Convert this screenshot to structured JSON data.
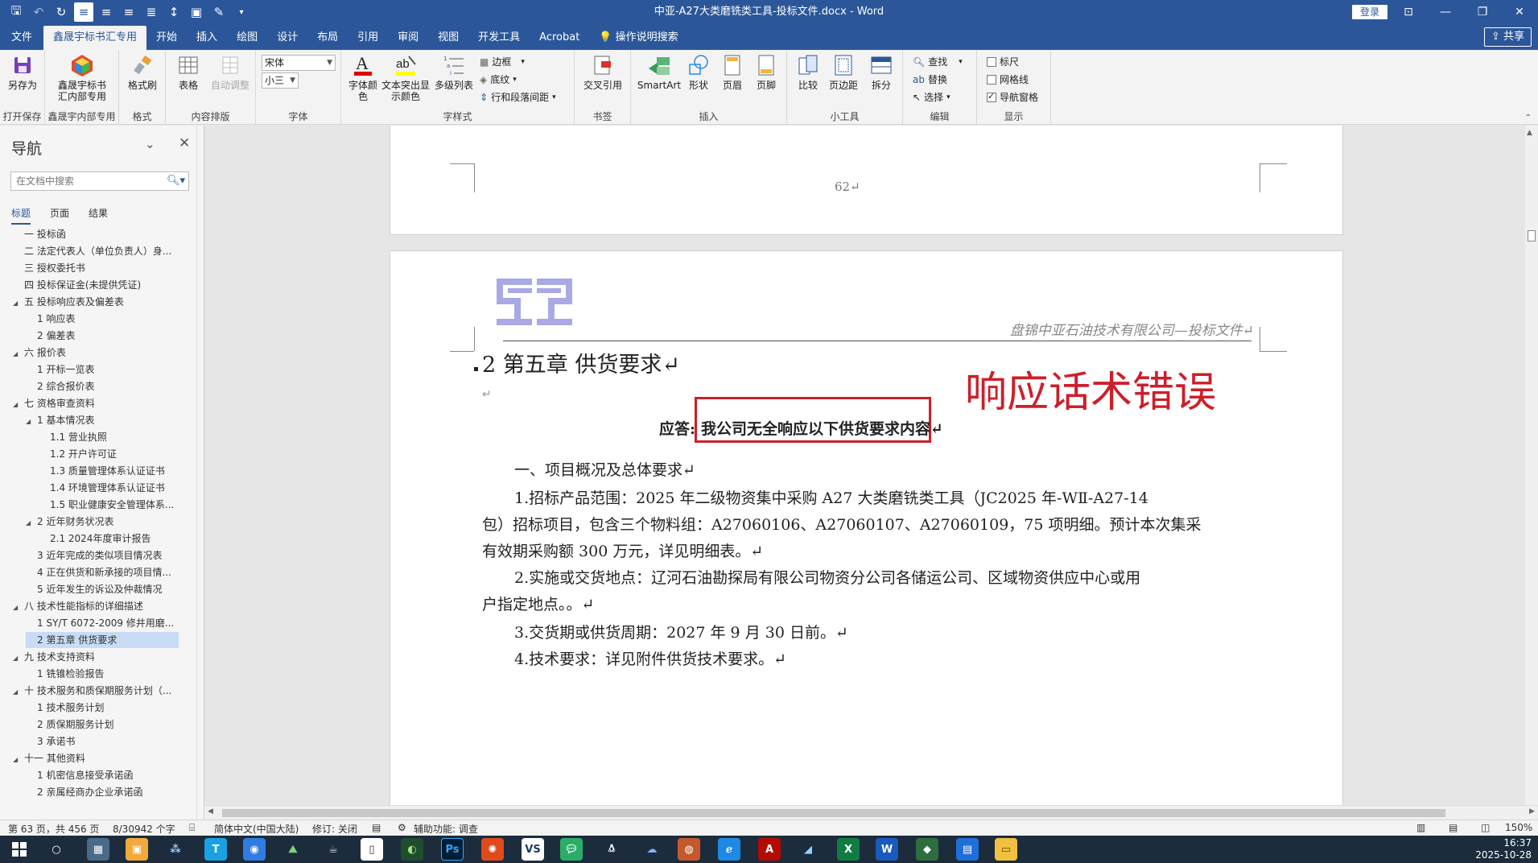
{
  "window": {
    "title": "中亚-A27大类磨铣类工具-投标文件.docx  -  Word",
    "login_label": "登录",
    "share_label": "共享"
  },
  "ribbon_tabs": [
    "文件",
    "鑫晟宇标书汇专用",
    "开始",
    "插入",
    "绘图",
    "设计",
    "布局",
    "引用",
    "审阅",
    "视图",
    "开发工具",
    "Acrobat",
    "操作说明搜索"
  ],
  "ribbon": {
    "save_as": "另存为",
    "open_save_group": "打开保存",
    "xsy_btn_line1": "鑫晟宇标书",
    "xsy_btn_line2": "汇内部专用",
    "xsy_group": "鑫晟宇内部专用",
    "format_painter": "格式刷",
    "format_group": "格式",
    "table": "表格",
    "auto_adjust": "自动调整",
    "content_group": "内容排版",
    "font_name": "宋体",
    "font_size": "小三",
    "font_group": "字体",
    "font_color_line1": "字体颜",
    "font_color_line2": "色",
    "highlight_line1": "文本突出显",
    "highlight_line2": "示颜色",
    "multilevel": "多级列表",
    "border": "边框",
    "shading": "底纹",
    "para_spacing": "行和段落间距",
    "style_group": "字样式",
    "cross_ref": "交叉引用",
    "bookmark_group": "书签",
    "smartart": "SmartArt",
    "shape": "形状",
    "header": "页眉",
    "footer": "页脚",
    "insert_group": "插入",
    "compare": "比较",
    "margins": "页边距",
    "split": "拆分",
    "tools_group": "小工具",
    "find": "查找",
    "replace": "替换",
    "select": "选择",
    "edit_group": "编辑",
    "ruler": "标尺",
    "gridlines": "网格线",
    "nav_pane": "导航窗格",
    "display_group": "显示"
  },
  "nav": {
    "title": "导航",
    "search_placeholder": "在文档中搜索",
    "tabs": [
      "标题",
      "页面",
      "结果"
    ],
    "items": [
      {
        "text": "一 投标函",
        "level": 0,
        "tri": ""
      },
      {
        "text": "二 法定代表人（单位负责人）身...",
        "level": 0,
        "tri": ""
      },
      {
        "text": "三 授权委托书",
        "level": 0,
        "tri": ""
      },
      {
        "text": "四 投标保证金(未提供凭证)",
        "level": 0,
        "tri": ""
      },
      {
        "text": "五 投标响应表及偏差表",
        "level": 0,
        "tri": "◢"
      },
      {
        "text": "1 响应表",
        "level": 1,
        "tri": ""
      },
      {
        "text": "2 偏差表",
        "level": 1,
        "tri": ""
      },
      {
        "text": "六 报价表",
        "level": 0,
        "tri": "◢"
      },
      {
        "text": "1 开标一览表",
        "level": 1,
        "tri": ""
      },
      {
        "text": "2 综合报价表",
        "level": 1,
        "tri": ""
      },
      {
        "text": "七 资格审查资料",
        "level": 0,
        "tri": "◢"
      },
      {
        "text": "1 基本情况表",
        "level": 1,
        "tri": "◢"
      },
      {
        "text": "1.1 营业执照",
        "level": 2,
        "tri": ""
      },
      {
        "text": "1.2 开户许可证",
        "level": 2,
        "tri": ""
      },
      {
        "text": "1.3 质量管理体系认证证书",
        "level": 2,
        "tri": ""
      },
      {
        "text": "1.4 环境管理体系认证证书",
        "level": 2,
        "tri": ""
      },
      {
        "text": "1.5 职业健康安全管理体系...",
        "level": 2,
        "tri": ""
      },
      {
        "text": "2 近年财务状况表",
        "level": 1,
        "tri": "◢"
      },
      {
        "text": "2.1 2024年度审计报告",
        "level": 2,
        "tri": ""
      },
      {
        "text": "3 近年完成的类似项目情况表",
        "level": 1,
        "tri": ""
      },
      {
        "text": "4 正在供货和新承接的项目情...",
        "level": 1,
        "tri": ""
      },
      {
        "text": "5 近年发生的诉讼及仲裁情况",
        "level": 1,
        "tri": ""
      },
      {
        "text": "八 技术性能指标的详细描述",
        "level": 0,
        "tri": "◢"
      },
      {
        "text": "1 SY/T 6072-2009 修井用磨...",
        "level": 1,
        "tri": ""
      },
      {
        "text": "2 第五章 供货要求",
        "level": 1,
        "tri": "",
        "selected": true
      },
      {
        "text": "九 技术支持资料",
        "level": 0,
        "tri": "◢"
      },
      {
        "text": "1 铣锥检验报告",
        "level": 1,
        "tri": ""
      },
      {
        "text": "十 技术服务和质保期服务计划（...",
        "level": 0,
        "tri": "◢"
      },
      {
        "text": "1 技术服务计划",
        "level": 1,
        "tri": ""
      },
      {
        "text": "2 质保期服务计划",
        "level": 1,
        "tri": ""
      },
      {
        "text": "3 承诺书",
        "level": 1,
        "tri": ""
      },
      {
        "text": "十一 其他资料",
        "level": 0,
        "tri": "◢"
      },
      {
        "text": "1 机密信息接受承诺函",
        "level": 1,
        "tri": ""
      },
      {
        "text": "2 亲属经商办企业承诺函",
        "level": 1,
        "tri": ""
      }
    ]
  },
  "document": {
    "page_number": "62↵",
    "header_text": "盘锦中亚石油技术有限公司—投标文件↵",
    "heading": "2 第五章  供货要求↵",
    "empty_mark": "↵",
    "answer_label": "应答:",
    "answer_text": "我公司无全响应以下供货要求内容↵",
    "annotation": "响应话术错误",
    "para_1": "一、项目概况及总体要求↵",
    "para_2a": "1.招标产品范围：2025 年二级物资集中采购 A27 大类磨铣类工具（JC2025 年-WⅡ-A27-14",
    "para_2b": "包）招标项目，包含三个物料组：A27060106、A27060107、A27060109，75 项明细。预计本次集采",
    "para_2c": "有效期采购额 300 万元，详见明细表。↵",
    "para_3a": "2.实施或交货地点：辽河石油勘探局有限公司物资分公司各储运公司、区域物资供应中心或用",
    "para_3b": "户指定地点。。↵",
    "para_4": "3.交货期或供货周期：2027 年 9 月 30 日前。↵",
    "para_5": "4.技术要求：详见附件供货技术要求。↵"
  },
  "status": {
    "page": "第 63 页，共 456 页",
    "words": "8/30942 个字",
    "language": "简体中文(中国大陆)",
    "track": "修订: 关闭",
    "accessibility": "辅助功能: 调查",
    "zoom": "150%"
  },
  "taskbar": {
    "time": "16:37",
    "date": "2025-10-28"
  },
  "colors": {
    "word_blue": "#2b579a",
    "annotation_red": "#cc1f2a"
  }
}
